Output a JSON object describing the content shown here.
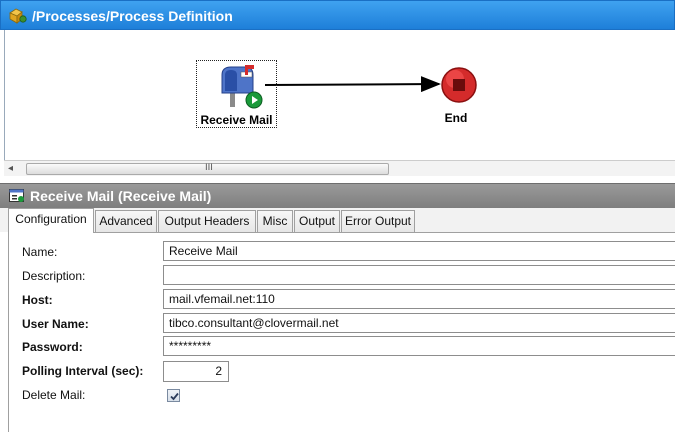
{
  "process": {
    "title": "/Processes/Process Definition",
    "activity_label": "Receive Mail",
    "end_label": "End",
    "scroll_grip": "III"
  },
  "properties": {
    "title": "Receive Mail (Receive Mail)",
    "tabs": [
      {
        "label": "Configuration",
        "active": true
      },
      {
        "label": "Advanced",
        "active": false
      },
      {
        "label": "Output Headers",
        "active": false
      },
      {
        "label": "Misc",
        "active": false
      },
      {
        "label": "Output",
        "active": false
      },
      {
        "label": "Error Output",
        "active": false
      }
    ],
    "fields": {
      "name": {
        "label": "Name:",
        "value": "Receive Mail"
      },
      "description": {
        "label": "Description:",
        "value": ""
      },
      "host": {
        "label": "Host:",
        "value": "mail.vfemail.net:110"
      },
      "user_name": {
        "label": "User Name:",
        "value": "tibco.consultant@clovermail.net"
      },
      "password": {
        "label": "Password:",
        "value": "*********"
      },
      "polling_interval": {
        "label": "Polling Interval (sec):",
        "value": "2"
      },
      "delete_mail": {
        "label": "Delete Mail:",
        "checked": true
      }
    }
  },
  "colors": {
    "title_blue": "#1e7fd9",
    "title_gray": "#8a8a8a",
    "end_red": "#d42b2b",
    "start_green": "#1a9a3a"
  }
}
